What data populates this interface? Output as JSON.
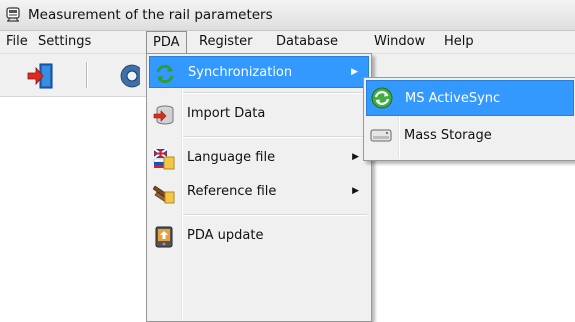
{
  "window": {
    "title": "Measurement of the rail parameters",
    "icon": "rail-car-icon"
  },
  "menubar": {
    "items": [
      "File",
      "Settings",
      "PDA",
      "Register",
      "Database",
      "Window",
      "Help"
    ],
    "active": "PDA"
  },
  "toolbar": {
    "buttons": [
      {
        "icon": "exit-door-icon"
      },
      {
        "icon": "gear-icon"
      }
    ]
  },
  "pda_menu": {
    "items": [
      {
        "label": "Synchronization",
        "icon": "sync-arrows-icon",
        "submenu": true,
        "highlighted": true
      },
      {
        "label": "Import Data",
        "icon": "import-data-icon",
        "submenu": false
      },
      {
        "label": "Language file",
        "icon": "language-flags-icon",
        "submenu": true
      },
      {
        "label": "Reference file",
        "icon": "reference-rail-icon",
        "submenu": true
      },
      {
        "label": "PDA update",
        "icon": "pda-device-icon",
        "submenu": false
      }
    ]
  },
  "sync_submenu": {
    "items": [
      {
        "label": "MS ActiveSync",
        "icon": "activesync-icon",
        "highlighted": true
      },
      {
        "label": "Mass Storage",
        "icon": "drive-icon",
        "highlighted": false
      }
    ]
  },
  "colors": {
    "highlight": "#3399ff",
    "menu_bg": "#f0f0f0"
  }
}
